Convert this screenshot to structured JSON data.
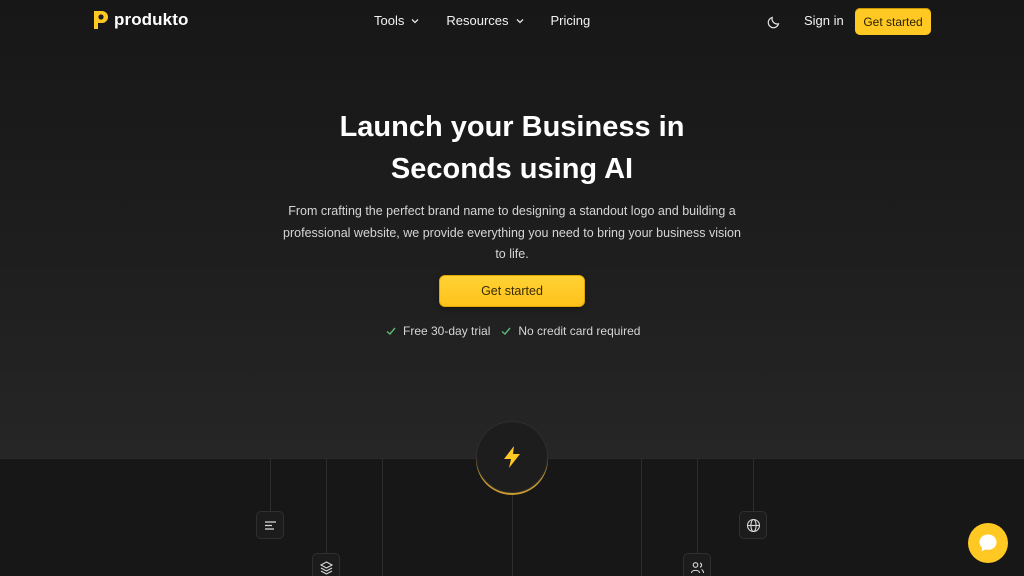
{
  "brand": {
    "name": "produkto",
    "accent": "#ffc823"
  },
  "nav": {
    "links": [
      {
        "label": "Tools",
        "has_dropdown": true
      },
      {
        "label": "Resources",
        "has_dropdown": true
      },
      {
        "label": "Pricing",
        "has_dropdown": false
      }
    ],
    "theme_toggle_icon": "moon-icon",
    "signin_label": "Sign in",
    "cta_label": "Get started"
  },
  "hero": {
    "title_line1": "Launch your Business in",
    "title_line2": "Seconds using AI",
    "subtitle": "From crafting the perfect brand name to designing a standout logo and building a professional website, we provide everything you need to bring your business vision to life.",
    "cta_label": "Get started",
    "checks": [
      "Free 30-day trial",
      "No credit card required"
    ]
  },
  "illustration": {
    "hub_icon": "lightning-bolt-icon",
    "node_icons": [
      "align-left-icon",
      "layers-icon",
      "globe-icon",
      "users-icon"
    ]
  },
  "chat": {
    "icon": "chat-bubble-icon"
  }
}
